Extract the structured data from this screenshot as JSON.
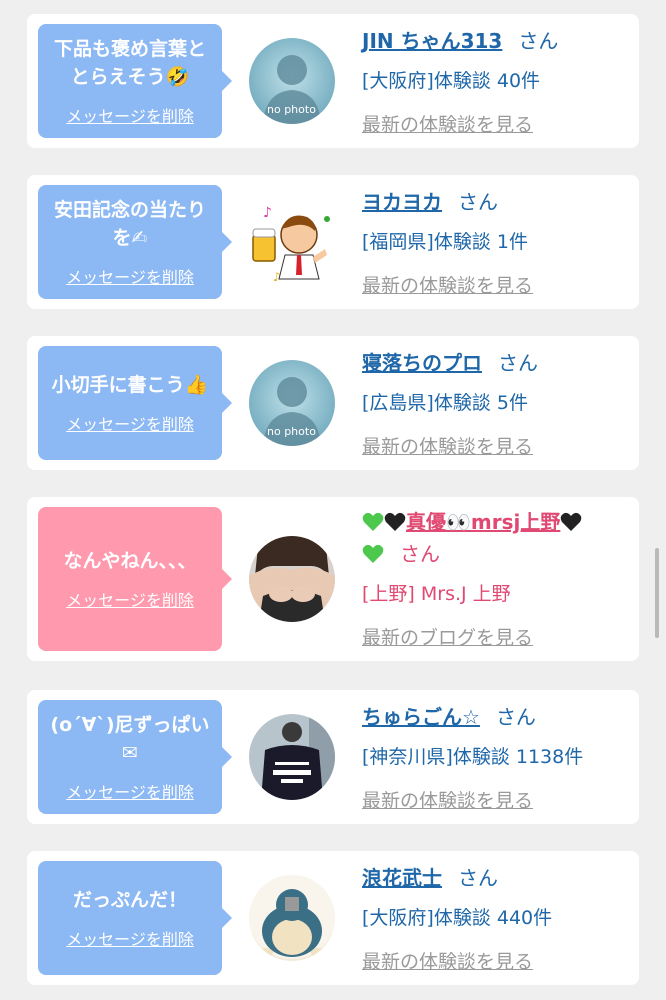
{
  "cards": [
    {
      "message": "下品も褒め言葉と\nとらえそう🤣",
      "delete_label": "メッセージを削除",
      "name": "JIN ちゃん313",
      "san": "さん",
      "meta": "[大阪府]体験談 40件",
      "latest": "最新の体験談を見る",
      "avatar": "no photo",
      "theme": "blue"
    },
    {
      "message": "安田記念の当たり\nを✍",
      "delete_label": "メッセージを削除",
      "name": "ヨカヨカ",
      "san": "さん",
      "meta": "[福岡県]体験談 1件",
      "latest": "最新の体験談を見る",
      "avatar": "cartoon-beer",
      "theme": "blue"
    },
    {
      "message": "小切手に書こう👍",
      "delete_label": "メッセージを削除",
      "name": "寝落ちのプロ",
      "san": "さん",
      "meta": "[広島県]体験談 5件",
      "latest": "最新の体験談を見る",
      "avatar": "no photo",
      "theme": "blue"
    },
    {
      "message": "なんやねん、、、",
      "delete_label": "メッセージを削除",
      "name": "真優👀mrsj上野",
      "san": "さん",
      "meta": "[上野] Mrs.J 上野",
      "latest": "最新のブログを見る",
      "avatar": "photo-woman",
      "theme": "pink"
    },
    {
      "message": "(o´∀`)尼ずっぱい✉",
      "delete_label": "メッセージを削除",
      "name": "ちゅらごん☆",
      "san": "さん",
      "meta": "[神奈川県]体験談 1138件",
      "latest": "最新の体験談を見る",
      "avatar": "photo-jacket",
      "theme": "blue"
    },
    {
      "message": "だっぷんだ！",
      "delete_label": "メッセージを削除",
      "name": "浪花武士",
      "san": "さん",
      "meta": "[大阪府]体験談 440件",
      "latest": "最新の体験談を見る",
      "avatar": "snorlax",
      "theme": "blue"
    }
  ],
  "no_photo_text": "no photo",
  "colors": {
    "bubble_blue": "#8cb8f3",
    "bubble_pink": "#ff99ad",
    "name_blue": "#1f67a8",
    "name_pink": "#e04a72",
    "latest_gray": "#9a9a9a"
  }
}
